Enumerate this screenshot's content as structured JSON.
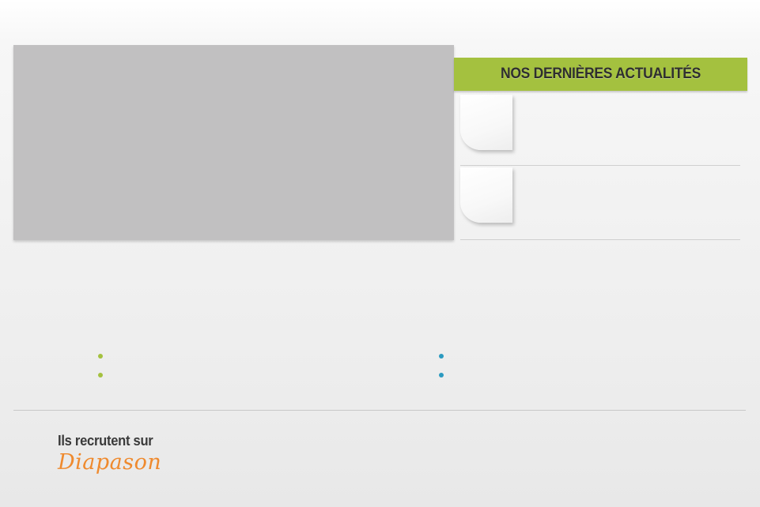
{
  "news": {
    "header_title": "NOS DERNIÈRES ACTUALITÉS",
    "items": [
      {
        "title": "",
        "thumbnail": "paper-note-icon"
      },
      {
        "title": "",
        "thumbnail": "paper-note-icon"
      }
    ]
  },
  "link_lists": {
    "left_bullet_color": "#a4c13f",
    "right_bullet_color": "#2b9ac0"
  },
  "recruit": {
    "title": "Ils recrutent sur",
    "brand": "Diapason",
    "brand_color": "#ef8a2e"
  },
  "colors": {
    "accent_green": "#a4c13f",
    "slider_placeholder": "#c1c0c1"
  }
}
